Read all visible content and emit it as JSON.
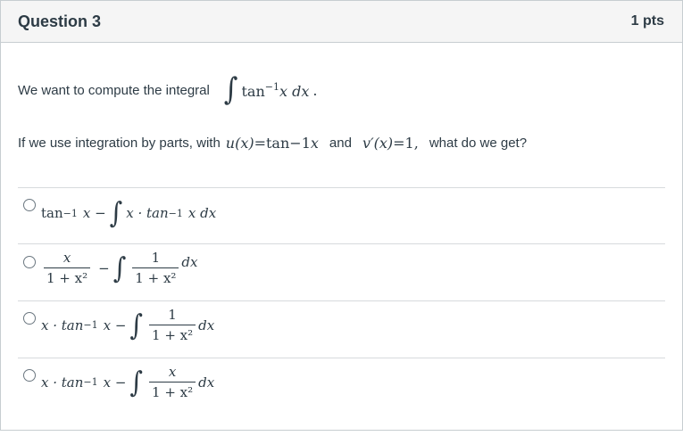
{
  "header": {
    "title": "Question 3",
    "points": "1 pts"
  },
  "question": {
    "line1_text": "We want to compute the integral",
    "line1_expr": "tan",
    "line1_sup": "−1",
    "line1_var": "x dx",
    "line1_end": ".",
    "line2_text": "If we use integration by parts, with",
    "line2_u": "u(x)",
    "line2_eq1": "=tan",
    "line2_sup": "−1",
    "line2_x": "x",
    "line2_and": "and",
    "line2_v": "v′(x)",
    "line2_eq2": "=1",
    "line2_comma": ",",
    "line2_tail": "what do we get?"
  },
  "answers": [
    {
      "label": "answer-1",
      "parts": {
        "a": "tan",
        "a_sup": "−1",
        "b": "x −",
        "c": "x · tan",
        "c_sup": "−1",
        "d": "x dx"
      }
    },
    {
      "label": "answer-2",
      "parts": {
        "num1": "x",
        "den1": "1 + x²",
        "minus": "−",
        "num2": "1",
        "den2": "1 + x²",
        "d": "dx"
      }
    },
    {
      "label": "answer-3",
      "parts": {
        "a": "x · tan",
        "a_sup": "−1",
        "b": "x −",
        "num": "1",
        "den": "1 + x²",
        "d": "dx"
      }
    },
    {
      "label": "answer-4",
      "parts": {
        "a": "x · tan",
        "a_sup": "−1",
        "b": "x −",
        "num": "x",
        "den": "1 + x²",
        "d": "dx"
      }
    }
  ]
}
